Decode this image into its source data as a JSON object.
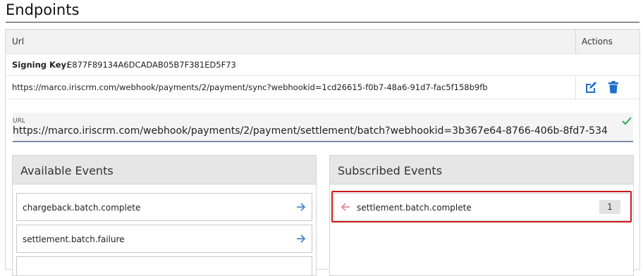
{
  "page": {
    "title": "Endpoints"
  },
  "table": {
    "col_url": "Url",
    "col_actions": "Actions",
    "signing_key_label": "Signing Key:",
    "signing_key_value": "E877F89134A6DCADAB05B7F381ED5F73",
    "webhook_url": "https://marco.iriscrm.com/webhook/payments/2/payment/sync?webhookid=1cd26615-f0b7-48a6-91d7-fac5f158b9fb"
  },
  "url_field": {
    "label": "URL",
    "value": "https://marco.iriscrm.com/webhook/payments/2/payment/settlement/batch?webhookid=3b367e64-8766-406b-8fd7-534"
  },
  "available": {
    "title": "Available Events",
    "events": [
      "chargeback.batch.complete",
      "settlement.batch.failure"
    ]
  },
  "subscribed": {
    "title": "Subscribed Events",
    "events": [
      {
        "name": "settlement.batch.complete",
        "count": "1"
      }
    ]
  },
  "icons": {
    "edit": "edit-icon",
    "delete": "trash-icon",
    "valid": "check-icon",
    "add": "arrow-right-icon",
    "remove": "arrow-left-icon"
  },
  "colors": {
    "accent_blue": "#1f6fc8",
    "arrow_blue": "#4a86c5",
    "remove_pink": "#e58a97",
    "highlight_red": "#cc1b1b",
    "check_green": "#2eaa55"
  }
}
